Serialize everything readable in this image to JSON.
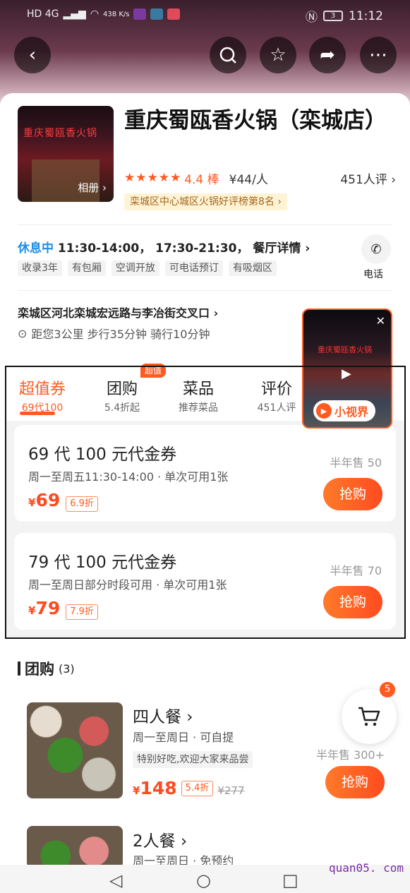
{
  "status_bar": {
    "network": "HD 4G",
    "speed": "438 K/s",
    "time": "11:12",
    "battery": "3"
  },
  "header": {
    "back_icon": "chevron-left-icon",
    "search_icon": "search-icon",
    "favorite_icon": "star-icon",
    "share_icon": "share-icon",
    "more_icon": "more-icon"
  },
  "shop": {
    "name": "重庆蜀瓯香火锅（栾城店）",
    "cover_sign": "重庆蜀瓯香火锅",
    "album_label": "相册 ›",
    "stars": "★★★★★",
    "score": "4.4 棒",
    "avg_price": "¥44/人",
    "reviews": "451人评 ›",
    "rank": "栾城区中心城区火锅好评榜第8名 ›"
  },
  "info": {
    "status": "休息中",
    "hours": "11:30-14:00， 17:30-21:30， 餐厅详情 ›",
    "tags": [
      "收录3年",
      "有包厢",
      "空调开放",
      "可电话预订",
      "有吸烟区"
    ],
    "phone_label": "电话",
    "address": "栾城区河北栾城宏远路与李冶街交叉口 ›",
    "distance": "距您3公里 步行35分钟 骑行10分钟"
  },
  "video": {
    "sign": "重庆蜀瓯香火锅",
    "brand": "小视界"
  },
  "tabs": [
    {
      "title": "超值券",
      "sub": "69代100"
    },
    {
      "title": "团购",
      "sub": "5.4折起"
    },
    {
      "title": "菜品",
      "sub": "推荐菜品"
    },
    {
      "title": "评价",
      "sub": "451人评"
    }
  ],
  "super_badge": "超值",
  "vouchers": [
    {
      "title": "69 代 100 元代金券",
      "desc": "周一至周五11:30-14:00 · 单次可用1张",
      "currency": "¥",
      "price": "69",
      "discount": "6.9折",
      "sold": "半年售 50",
      "button": "抢购"
    },
    {
      "title": "79 代 100 元代金券",
      "desc": "周一至周日部分时段可用 · 单次可用1张",
      "currency": "¥",
      "price": "79",
      "discount": "7.9折",
      "sold": "半年售 70",
      "button": "抢购"
    }
  ],
  "group": {
    "title": "团购",
    "count": "(3)",
    "items": [
      {
        "name": "四人餐 ›",
        "desc": "周一至周日 · 可自提",
        "tag": "特别好吃,欢迎大家来品尝",
        "currency": "¥",
        "price": "148",
        "discount": "5.4折",
        "original": "¥277",
        "sold": "半年售 300+",
        "button": "抢购"
      },
      {
        "name": "2人餐 ›",
        "desc": "周一至周日 · 免预约"
      }
    ]
  },
  "cart": {
    "badge": "5"
  },
  "watermark": "quan05. com"
}
